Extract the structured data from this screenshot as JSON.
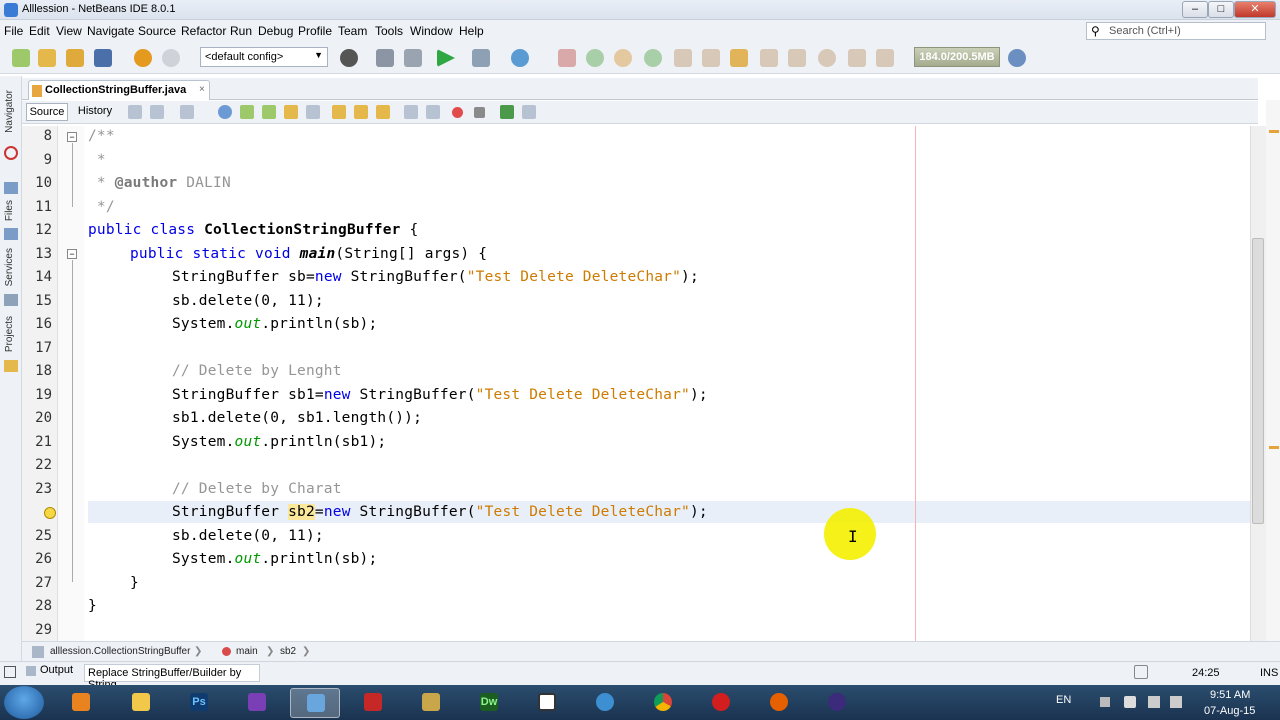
{
  "window": {
    "title": "Alllession - NetBeans IDE 8.0.1",
    "minimize": "‒",
    "maximize": "□",
    "close": "✕"
  },
  "menu": [
    "File",
    "Edit",
    "View",
    "Navigate",
    "Source",
    "Refactor",
    "Run",
    "Debug",
    "Profile",
    "Team",
    "Tools",
    "Window",
    "Help"
  ],
  "search": {
    "placeholder": "Search (Ctrl+I)"
  },
  "toolbar": {
    "config": "<default config>",
    "memory": "184.0/200.5MB"
  },
  "side_panels": [
    "Navigator",
    "Files",
    "Services",
    "Projects"
  ],
  "tab": {
    "label": "CollectionStringBuffer.java",
    "close": "×"
  },
  "editor_toolbar": {
    "source": "Source",
    "history": "History"
  },
  "code_lines": [
    {
      "n": "8"
    },
    {
      "n": "9"
    },
    {
      "n": "10"
    },
    {
      "n": "11"
    },
    {
      "n": "12"
    },
    {
      "n": "13"
    },
    {
      "n": "14"
    },
    {
      "n": "15"
    },
    {
      "n": "16"
    },
    {
      "n": "17"
    },
    {
      "n": "18"
    },
    {
      "n": "19"
    },
    {
      "n": "20"
    },
    {
      "n": "21"
    },
    {
      "n": "22"
    },
    {
      "n": "23"
    },
    {
      "n": "25"
    },
    {
      "n": "26"
    },
    {
      "n": "27"
    },
    {
      "n": "28"
    },
    {
      "n": "29"
    }
  ],
  "code": {
    "l8": "/**",
    "l9": " *",
    "l10a": " * ",
    "l10b": "@author",
    "l10c": " DALIN",
    "l11": " */",
    "l12a": "public class ",
    "l12b": "CollectionStringBuffer",
    "l12c": " {",
    "l13a": "public static void ",
    "l13b": "main",
    "l13c": "(String[] args) {",
    "l14a": "StringBuffer sb=",
    "l14b": "new",
    "l14c": " StringBuffer(",
    "l14d": "\"Test Delete DeleteChar\"",
    "l14e": ");",
    "l15": "sb.delete(0, 11);",
    "l16a": "System.",
    "l16b": "out",
    "l16c": ".println(sb);",
    "l18": "// Delete by Lenght",
    "l19a": "StringBuffer sb1=",
    "l19b": "new",
    "l19c": " StringBuffer(",
    "l19d": "\"Test Delete DeleteChar\"",
    "l19e": ");",
    "l20": "sb1.delete(0, sb1.length());",
    "l21a": "System.",
    "l21b": "out",
    "l21c": ".println(sb1);",
    "l23": "// Delete by Charat",
    "l24a": "StringBuffer ",
    "l24b": "sb2",
    "l24c": "=",
    "l24d": "new",
    "l24e": " StringBuffer(",
    "l24f": "\"Test Delete DeleteChar\"",
    "l24g": ");",
    "l25": "sb.delete(0, 11);",
    "l26a": "System.",
    "l26b": "out",
    "l26c": ".println(sb);",
    "l27": "}",
    "l28": "}"
  },
  "breadcrumb": [
    "alllession.CollectionStringBuffer",
    "main",
    "sb2"
  ],
  "status": {
    "output": "Output",
    "message": "Replace StringBuffer/Builder by String",
    "caret": "24:25",
    "mode": "INS"
  },
  "taskbar": {
    "lang": "EN",
    "time": "9:51 AM",
    "date": "07-Aug-15",
    "apps": [
      "Ps",
      "Dw"
    ]
  }
}
